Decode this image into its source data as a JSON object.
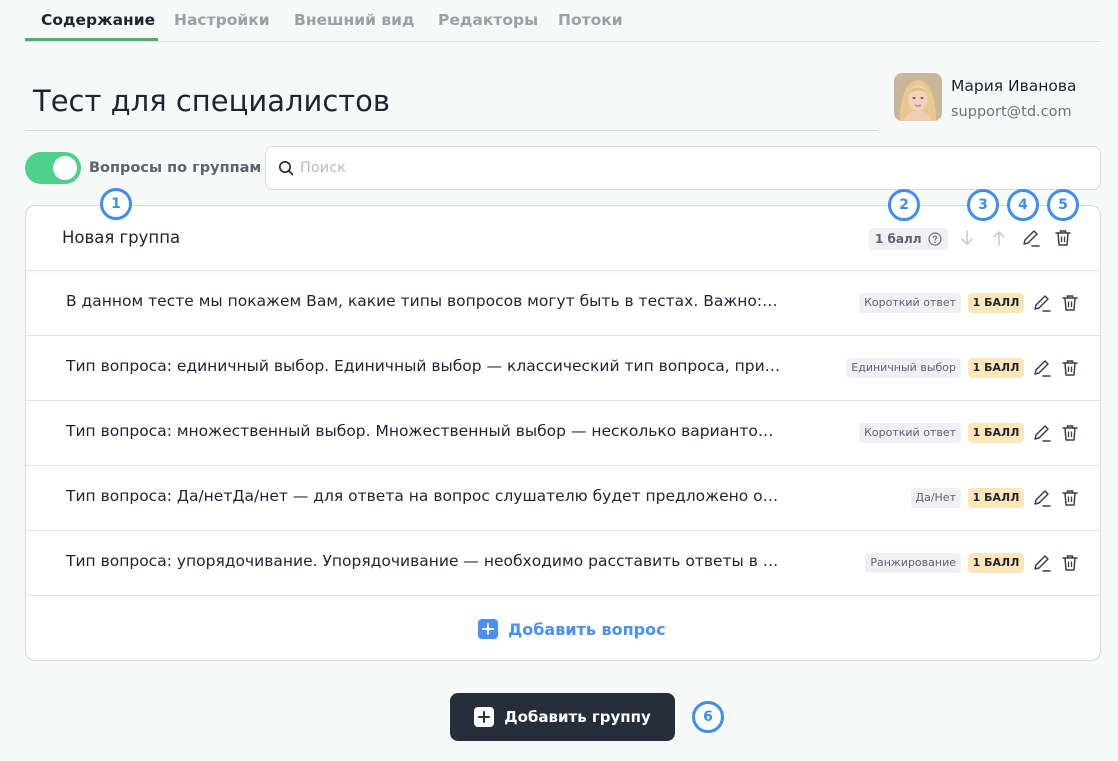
{
  "tabs": [
    {
      "label": "Содержание",
      "active": true
    },
    {
      "label": "Настройки"
    },
    {
      "label": "Внешний вид"
    },
    {
      "label": "Редакторы"
    },
    {
      "label": "Потоки"
    }
  ],
  "page": {
    "title": "Тест для специалистов"
  },
  "user": {
    "name": "Мария Иванова",
    "email": "support@td.com"
  },
  "toolbar": {
    "toggle_label": "Вопросы по группам",
    "toggle_on": true,
    "search_placeholder": "Поиск"
  },
  "group": {
    "name": "Новая группа",
    "score": "1 балл"
  },
  "questions": [
    {
      "text": "В данном тесте мы покажем Вам, какие типы вопросов могут быть в тестах. Важно: Вы о...",
      "type": "Короткий ответ",
      "score": "1 БАЛЛ"
    },
    {
      "text": "Тип вопроса: единичный выбор. Единичный выбор — классический тип вопроса, при ко...",
      "type": "Единичный выбор",
      "score": "1 БАЛЛ"
    },
    {
      "text": "Тип вопроса: множественный выбор. Множественный выбор — несколько вариантов от...",
      "type": "Короткий ответ",
      "score": "1 БАЛЛ"
    },
    {
      "text": "Тип вопроса: Да/нетДа/нет — для ответа на вопрос слушателю будет предложено ответ...",
      "type": "Да/Нет",
      "score": "1 БАЛЛ"
    },
    {
      "text": "Тип вопроса: упорядочивание. Упорядочивание — необходимо расставить ответы в пр...",
      "type": "Ранжирование",
      "score": "1 БАЛЛ"
    }
  ],
  "actions": {
    "add_question": "Добавить вопрос",
    "add_group": "Добавить группу"
  },
  "markers": [
    "1",
    "2",
    "3",
    "4",
    "5",
    "6"
  ],
  "colors": {
    "accent_green": "#4caf6d",
    "toggle_green": "#4ed08a",
    "marker_blue": "#3b8ef2",
    "link_blue": "#4a90f0",
    "dark_button": "#262d3b",
    "score_badge": "#fde7b8"
  },
  "icons": [
    "search-icon",
    "help-icon",
    "arrow-down-icon",
    "arrow-up-icon",
    "pencil-icon",
    "trash-icon",
    "plus-icon"
  ]
}
